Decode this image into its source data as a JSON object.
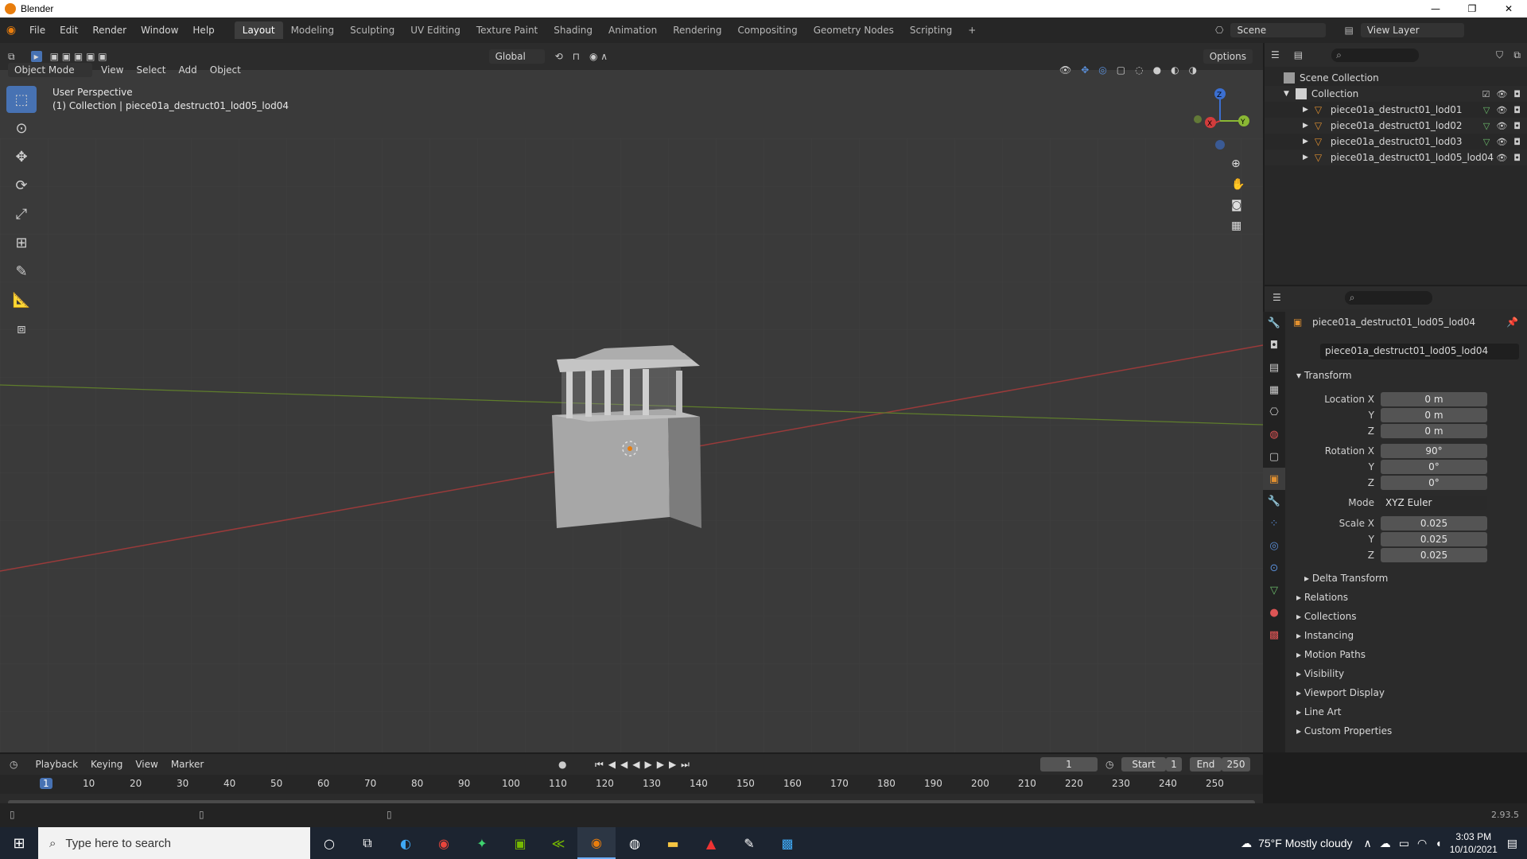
{
  "window": {
    "title": "Blender",
    "minimize": "—",
    "maximize": "❐",
    "close": "✕"
  },
  "menu": [
    "File",
    "Edit",
    "Render",
    "Window",
    "Help"
  ],
  "workspaces": [
    "Layout",
    "Modeling",
    "Sculpting",
    "UV Editing",
    "Texture Paint",
    "Shading",
    "Animation",
    "Rendering",
    "Compositing",
    "Geometry Nodes",
    "Scripting"
  ],
  "active_workspace": "Layout",
  "scene": {
    "label": "Scene",
    "view_layer": "View Layer"
  },
  "viewport": {
    "transform_orientation": "Global",
    "options": "Options",
    "mode": "Object Mode",
    "header_menus": [
      "View",
      "Select",
      "Add",
      "Object"
    ],
    "perspective": "User Perspective",
    "collection_info": "(1) Collection | piece01a_destruct01_lod05_lod04",
    "gizmo_axes": {
      "x": "X",
      "y": "Y",
      "z": "Z"
    }
  },
  "outliner": {
    "scene_collection": "Scene Collection",
    "collection": "Collection",
    "items": [
      "piece01a_destruct01_lod01",
      "piece01a_destruct01_lod02",
      "piece01a_destruct01_lod03",
      "piece01a_destruct01_lod05_lod04"
    ]
  },
  "properties": {
    "object_name": "piece01a_destruct01_lod05_lod04",
    "data_name": "piece01a_destruct01_lod05_lod04",
    "transform_title": "Transform",
    "location_label": "Location X",
    "location": [
      "0 m",
      "0 m",
      "0 m"
    ],
    "rotation_label": "Rotation X",
    "rotation": [
      "90°",
      "0°",
      "0°"
    ],
    "mode_label": "Mode",
    "mode_value": "XYZ Euler",
    "scale_label": "Scale X",
    "scale": [
      "0.025",
      "0.025",
      "0.025"
    ],
    "axis_y": "Y",
    "axis_z": "Z",
    "delta_transform": "Delta Transform",
    "sections": [
      "Relations",
      "Collections",
      "Instancing",
      "Motion Paths",
      "Visibility",
      "Viewport Display",
      "Line Art",
      "Custom Properties"
    ]
  },
  "timeline": {
    "menus": [
      "Playback",
      "Keying",
      "View",
      "Marker"
    ],
    "current_frame": "1",
    "start_label": "Start",
    "start": "1",
    "end_label": "End",
    "end": "250",
    "ticks": [
      "1",
      "10",
      "20",
      "30",
      "40",
      "50",
      "60",
      "70",
      "80",
      "90",
      "100",
      "110",
      "120",
      "130",
      "140",
      "150",
      "160",
      "170",
      "180",
      "190",
      "200",
      "210",
      "220",
      "230",
      "240",
      "250"
    ]
  },
  "status": {
    "version": "2.93.5"
  },
  "taskbar": {
    "search_placeholder": "Type here to search",
    "weather": "75°F  Mostly cloudy",
    "time": "3:03 PM",
    "date": "10/10/2021"
  }
}
